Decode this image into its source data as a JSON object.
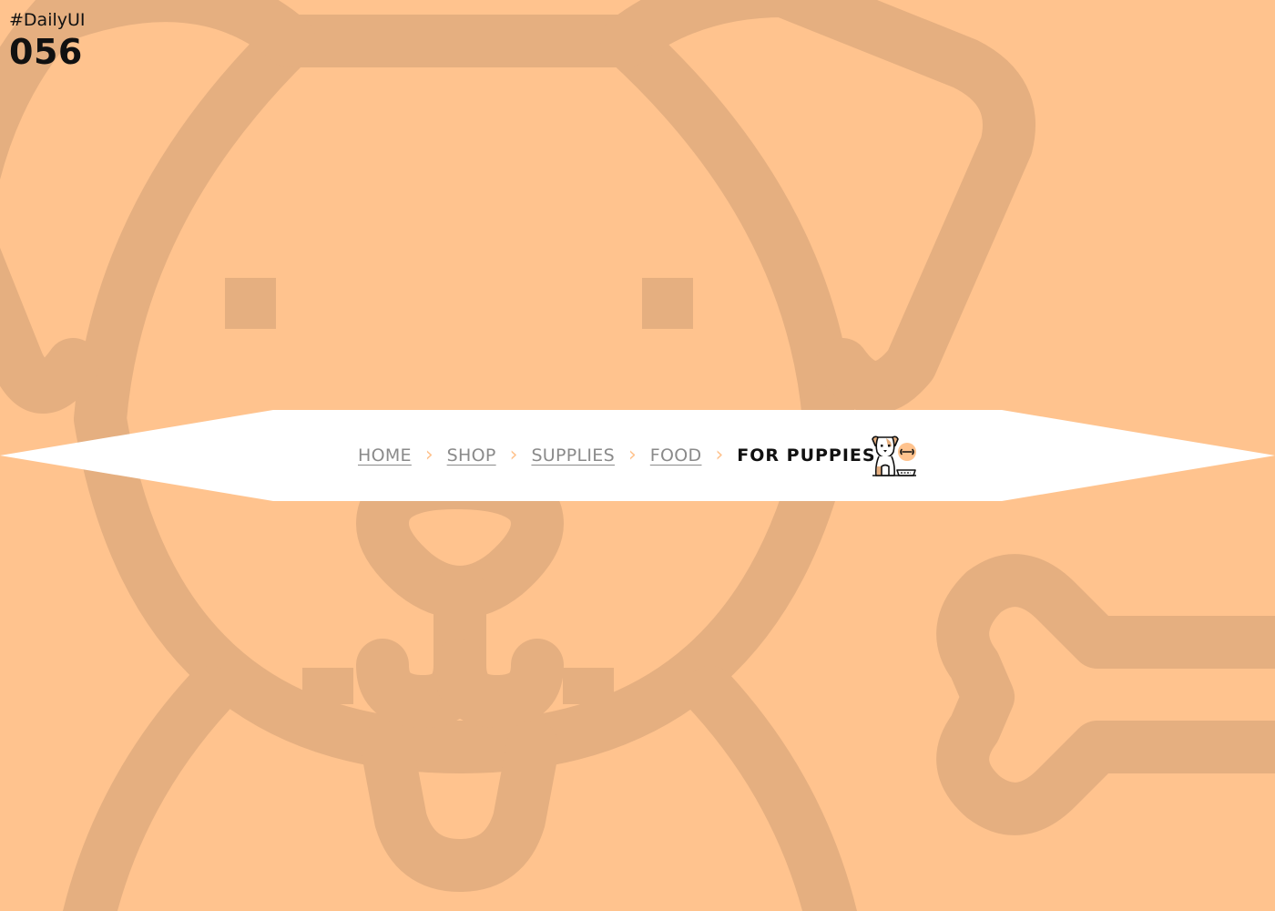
{
  "challenge": {
    "tag": "#DailyUI",
    "number": "056"
  },
  "breadcrumb": {
    "separator": "›",
    "items": [
      {
        "label": "HOME"
      },
      {
        "label": "SHOP"
      },
      {
        "label": "SUPPLIES"
      },
      {
        "label": "FOOD"
      }
    ],
    "current": "FOR PUPPIES",
    "icon": "puppy-with-bone-and-bowl-icon"
  },
  "colors": {
    "background": "#FFC38E",
    "artwork": "#E5AF80",
    "ribbon": "#FFFFFF",
    "separator": "#FFC38E",
    "link": "#8A8A8A",
    "current": "#111111"
  }
}
